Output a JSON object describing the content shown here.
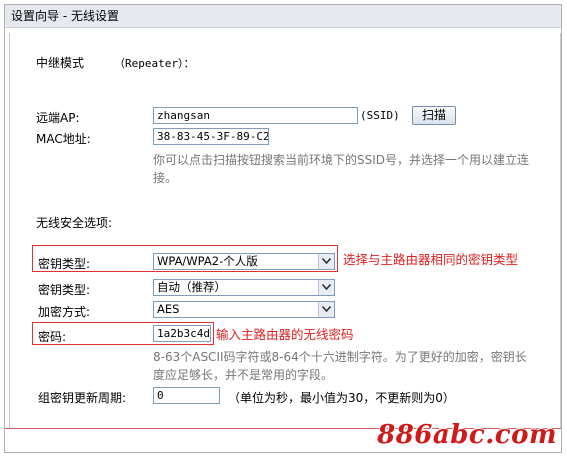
{
  "window": {
    "title": "设置向导 - 无线设置"
  },
  "mode": {
    "label": "中继模式",
    "value": "（Repeater）："
  },
  "remote_ap": {
    "label": "远端AP:",
    "value": "zhangsan",
    "suffix": "(SSID)",
    "scan_button": "扫描"
  },
  "mac": {
    "label": "MAC地址:",
    "value": "38-83-45-3F-89-C2"
  },
  "scan_hint": "你可以点击扫描按钮搜索当前环境下的SSID号，并选择一个用以建立连接。",
  "security": {
    "heading": "无线安全选项:"
  },
  "key_type": {
    "label": "密钥类型:",
    "value": "WPA/WPA2-个人版",
    "annotation": "选择与主路由器相同的密钥类型"
  },
  "key_type2": {
    "label": "密钥类型:",
    "value": "自动（推荐）"
  },
  "encryption": {
    "label": "加密方式:",
    "value": "AES"
  },
  "password": {
    "label": "密码:",
    "value": "1a2b3c4d",
    "annotation": "输入主路由器的无线密码",
    "hint": "8-63个ASCII码字符或8-64个十六进制字符。为了更好的加密，密钥长度应足够长，并不是常用的字段。"
  },
  "group_key": {
    "label": "组密钥更新周期:",
    "value": "0",
    "hint": "（单位为秒，最小值为30，不更新则为0）"
  },
  "watermark": "886abc.com"
}
